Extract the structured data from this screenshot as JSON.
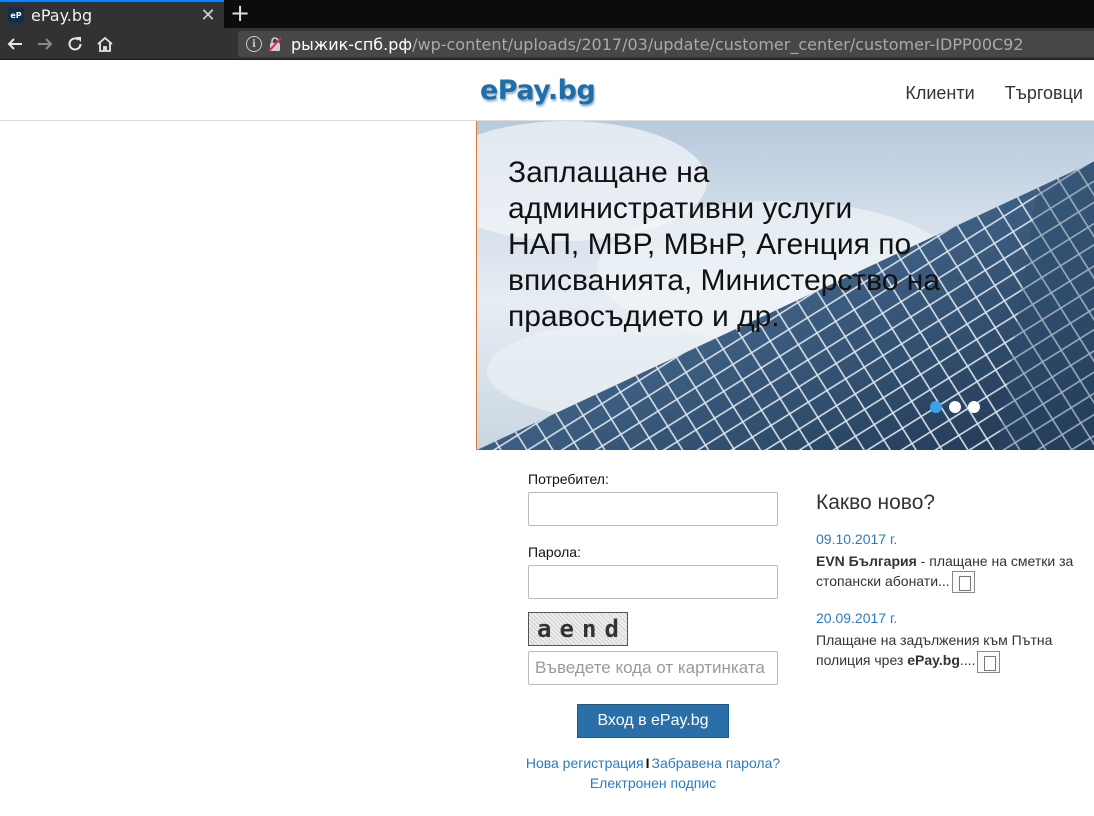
{
  "browser": {
    "tab_title": "ePay.bg",
    "favicon_text": "eP",
    "url_host": "рыжик-спб.рф",
    "url_path": "/wp-content/uploads/2017/03/update/customer_center/customer-IDPP00C92"
  },
  "header": {
    "logo": "ePay.bg",
    "nav": [
      "Клиенти",
      "Търговци"
    ]
  },
  "banner": {
    "line1": "Заплащане на административни услуги",
    "line2": "НАП, МВР, МВнР, Агенция по вписванията, Министерство на правосъдието и др.",
    "slides": 3,
    "active_slide": 1
  },
  "login": {
    "user_label": "Потребител:",
    "password_label": "Парола:",
    "captcha_chars": [
      "a",
      "e",
      "n",
      "d"
    ],
    "captcha_placeholder": "Въведете кода от картинката",
    "submit_label": "Вход в ePay.bg",
    "register_link": "Нова регистрация",
    "separator": "I",
    "forgot_link": "Забравена парола?",
    "esign_link": "Електронен подпис"
  },
  "news": {
    "title": "Какво ново?",
    "items": [
      {
        "date": "09.10.2017 г.",
        "bold": "EVN България",
        "text": " - плащане на сметки за стопански абонати..."
      },
      {
        "date": "20.09.2017 г.",
        "pre": "Плащане на задължения към Пътна полиция чрез ",
        "bold": "ePay.bg",
        "text": "...."
      }
    ]
  },
  "colors": {
    "accent": "#2a6fa8",
    "link": "#2a7bbf",
    "active_dot": "#3aa0e8"
  }
}
